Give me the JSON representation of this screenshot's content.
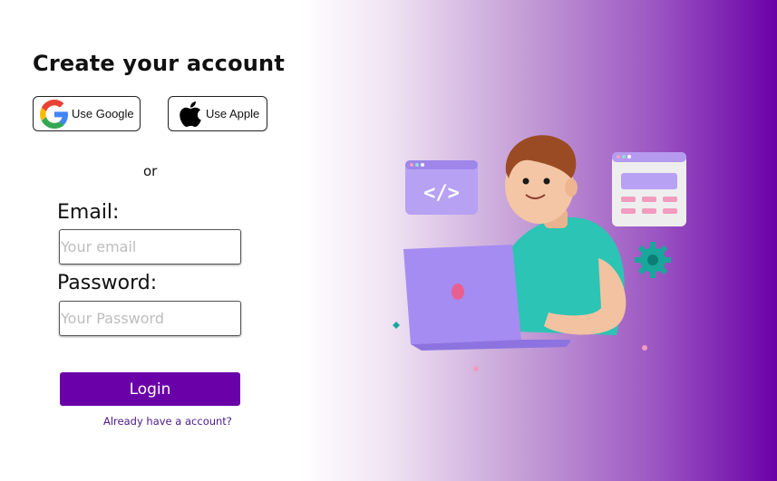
{
  "form": {
    "title": "Create your account",
    "google_label": "Use Google",
    "apple_label": "Use Apple",
    "or_text": "or",
    "email_label": "Email:",
    "email_placeholder": "Your email",
    "email_value": "",
    "password_label": "Password:",
    "password_placeholder": "Your Password",
    "password_value": "",
    "login_label": "Login",
    "already_link": "Already have a account?"
  },
  "icons": {
    "google": "google-logo-icon",
    "apple": "apple-logo-icon"
  },
  "colors": {
    "accent": "#6a00a8",
    "link": "#4b1a8c",
    "gradient_end": "#6a00a8"
  }
}
